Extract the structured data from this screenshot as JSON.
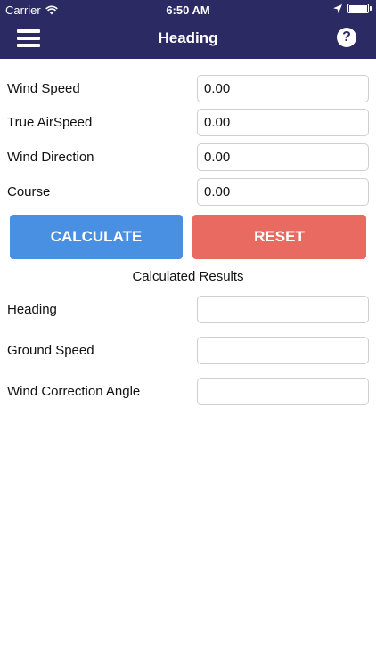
{
  "status_bar": {
    "carrier": "Carrier",
    "time": "6:50 AM"
  },
  "nav": {
    "title": "Heading"
  },
  "inputs": [
    {
      "label": "Wind Speed",
      "value": "0.00"
    },
    {
      "label": "True AirSpeed",
      "value": "0.00"
    },
    {
      "label": "Wind Direction",
      "value": "0.00"
    },
    {
      "label": "Course",
      "value": "0.00"
    }
  ],
  "buttons": {
    "calculate": "CALCULATE",
    "reset": "RESET"
  },
  "results": {
    "title": "Calculated Results",
    "fields": [
      {
        "label": "Heading",
        "value": ""
      },
      {
        "label": "Ground Speed",
        "value": ""
      },
      {
        "label": "Wind Correction Angle",
        "value": ""
      }
    ]
  },
  "colors": {
    "nav_bg": "#2b2a63",
    "calculate": "#4a90e2",
    "reset": "#e86a60"
  }
}
